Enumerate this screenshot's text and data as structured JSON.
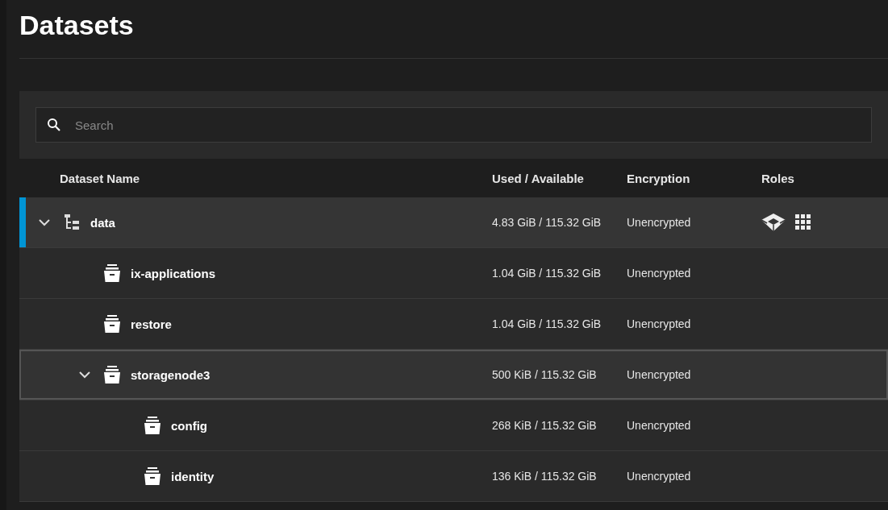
{
  "page": {
    "title": "Datasets"
  },
  "search": {
    "placeholder": "Search"
  },
  "table": {
    "columns": [
      "Dataset Name",
      "Used / Available",
      "Encryption",
      "Roles"
    ],
    "rows": [
      {
        "kind": "pool",
        "name": "data",
        "used": "4.83 GiB / 115.32 GiB",
        "encryption": "Unencrypted",
        "selected": true,
        "focused": false,
        "expanded": true,
        "roles": [
          {
            "kind": "apps"
          },
          {
            "kind": "grid"
          }
        ],
        "children": [
          {
            "kind": "dataset",
            "name": "ix-applications",
            "used": "1.04 GiB / 115.32 GiB",
            "encryption": "Unencrypted",
            "selected": false,
            "focused": false
          },
          {
            "kind": "dataset",
            "name": "restore",
            "used": "1.04 GiB / 115.32 GiB",
            "encryption": "Unencrypted",
            "selected": false,
            "focused": false
          },
          {
            "kind": "dataset",
            "name": "storagenode3",
            "used": "500 KiB / 115.32 GiB",
            "encryption": "Unencrypted",
            "selected": false,
            "focused": true,
            "expanded": true,
            "children": [
              {
                "kind": "dataset",
                "name": "config",
                "used": "268 KiB / 115.32 GiB",
                "encryption": "Unencrypted",
                "selected": false,
                "focused": false
              },
              {
                "kind": "dataset",
                "name": "identity",
                "used": "136 KiB / 115.32 GiB",
                "encryption": "Unencrypted",
                "selected": false,
                "focused": false
              }
            ]
          }
        ]
      }
    ]
  }
}
